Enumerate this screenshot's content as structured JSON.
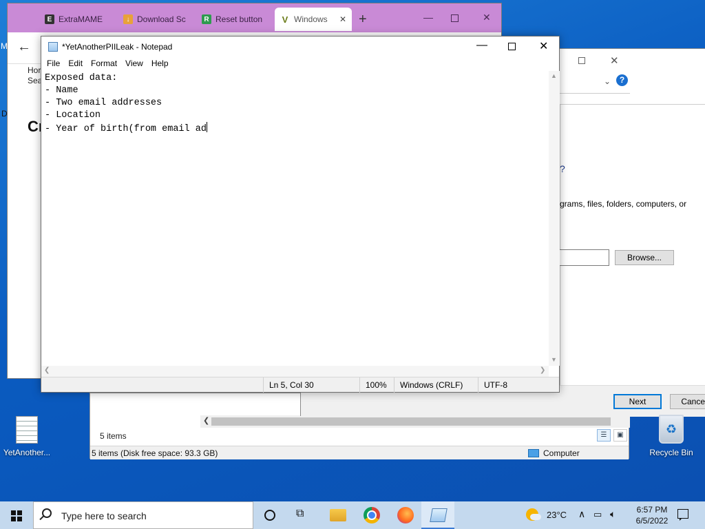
{
  "browser": {
    "tabs": [
      {
        "label": "ExtraMAME",
        "favicon": "extramame-icon"
      },
      {
        "label": "Download Sc",
        "favicon": "download-icon"
      },
      {
        "label": "Reset button",
        "favicon": "reset-icon"
      },
      {
        "label": "Windows",
        "favicon": "vivaldi-icon",
        "active": true
      }
    ],
    "new_tab": "+",
    "page_lines": [
      "Hor",
      "Sea"
    ],
    "heading_fragment": "Cr",
    "left_edge_chars": [
      "M",
      "D"
    ],
    "accent": "#c98ad6"
  },
  "dialog": {
    "question_fragment": "?",
    "description_fragment": "grams, files, folders, computers, or",
    "browse_label": "Browse...",
    "next_label": "Next",
    "cancel_label": "Cancel",
    "help": "?"
  },
  "explorer": {
    "items_count": "5 items",
    "status_left": "5 items (Disk free space: 93.3 GB)",
    "status_right": "Computer"
  },
  "notepad": {
    "title": "*YetAnotherPIILeak - Notepad",
    "menu": [
      "File",
      "Edit",
      "Format",
      "View",
      "Help"
    ],
    "content": "Exposed data:\n- Name\n- Two email addresses\n- Location\n- Year of birth(from email ad",
    "status": {
      "position": "Ln 5, Col 30",
      "zoom": "100%",
      "line_ending": "Windows (CRLF)",
      "encoding": "UTF-8"
    }
  },
  "desktop": {
    "icons": [
      {
        "label": "YetAnother...",
        "icon": "text-file-icon"
      },
      {
        "label": "Recycle Bin",
        "icon": "recycle-bin-icon"
      }
    ]
  },
  "taskbar": {
    "search_placeholder": "Type here to search",
    "weather": "23°C",
    "time": "6:57 PM",
    "date": "6/5/2022",
    "accent": "#3a7bd5"
  }
}
